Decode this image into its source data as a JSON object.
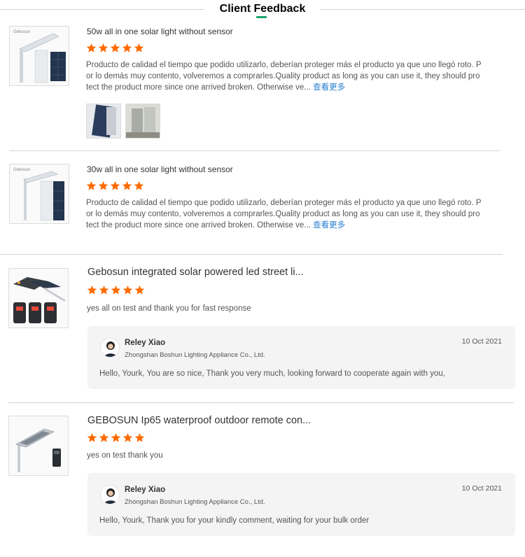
{
  "header": {
    "title": "Client Feedback"
  },
  "colors": {
    "star": "#ff6a00",
    "link": "#2a7fd0",
    "accent": "#1aa36b"
  },
  "reviews": [
    {
      "product_title": "50w all in one solar light without sensor",
      "rating": 5,
      "text": "Producto de calidad el tiempo que podido utilizarlo, deberían proteger más el producto ya que uno llegó roto. Por lo demás muy contento, volveremos a comprarles.Quality product as long as you can use it, they should protect the product more since one arrived broken.  Otherwise ve...",
      "more_label": "查看更多",
      "thumb_brand": "Gebosun"
    },
    {
      "product_title": "30w all in one solar light without sensor",
      "rating": 5,
      "text": "Producto de calidad el tiempo que podido utilizarlo, deberían proteger más el producto ya que uno llegó roto. Por lo demás muy contento, volveremos a comprarles.Quality product as long as you can use it, they should protect the product more since one arrived broken.  Otherwise ve...",
      "more_label": "查看更多",
      "thumb_brand": "Gebosun"
    },
    {
      "product_title": "Gebosun integrated solar powered led street li...",
      "rating": 5,
      "text": "yes all on test and thank you for fast response",
      "reply": {
        "name": "Reley Xiao",
        "company": "Zhongshan Boshun Lighting Appliance Co., Ltd.",
        "date": "10 Oct 2021",
        "text": "Hello, Yourk, You are so nice, Thank you very much, looking forward to cooperate again with you,"
      }
    },
    {
      "product_title": "GEBOSUN Ip65 waterproof outdoor remote con...",
      "rating": 5,
      "text": "yes on test thank you",
      "reply": {
        "name": "Reley Xiao",
        "company": "Zhongshan Boshun Lighting Appliance Co., Ltd.",
        "date": "10 Oct 2021",
        "text": "Hello, Yourk, Thank you for your kindly comment, waiting for your bulk order"
      }
    }
  ]
}
